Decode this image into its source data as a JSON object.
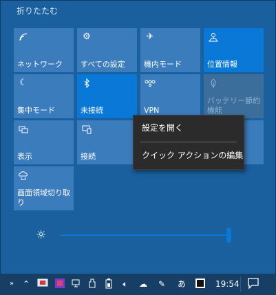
{
  "panel": {
    "collapse_label": "折りたたむ"
  },
  "tiles": [
    {
      "label": "ネットワーク",
      "icon": "network-icon"
    },
    {
      "label": "すべての設定",
      "icon": "gear-icon"
    },
    {
      "label": "機内モード",
      "icon": "airplane-icon"
    },
    {
      "label": "位置情報",
      "icon": "location-icon"
    },
    {
      "label": "集中モード",
      "icon": "moon-icon"
    },
    {
      "label": "未接続",
      "icon": "bluetooth-icon"
    },
    {
      "label": "VPN",
      "icon": "vpn-icon"
    },
    {
      "label": "バッテリー節約機能",
      "icon": "battery-saver-icon"
    },
    {
      "label": "表示",
      "icon": "project-icon"
    },
    {
      "label": "接続",
      "icon": "connect-icon"
    },
    {
      "label": "画面領域切り取り",
      "icon": "snip-icon"
    }
  ],
  "brightness": {
    "icon": "sun-icon",
    "level": 0.97
  },
  "context_menu": {
    "items": [
      "設定を開く",
      "クイック アクションの編集"
    ]
  },
  "taskbar": {
    "clock": "19:54",
    "icons": [
      "overflow-chevron-icon",
      "show-hidden-icon",
      "tablet-icon",
      "app-icon",
      "network-icon",
      "usb-icon",
      "battery-icon",
      "volume-icon",
      "cloud-icon",
      "pen-icon",
      "ime-icon",
      "badge-icon"
    ],
    "notification_icon": "action-center-icon"
  },
  "colors": {
    "background": "#1a5f9e",
    "tile_off": "#3b7cbd",
    "tile_on": "#0a78d7",
    "menu_bg": "#2b2b2b"
  }
}
